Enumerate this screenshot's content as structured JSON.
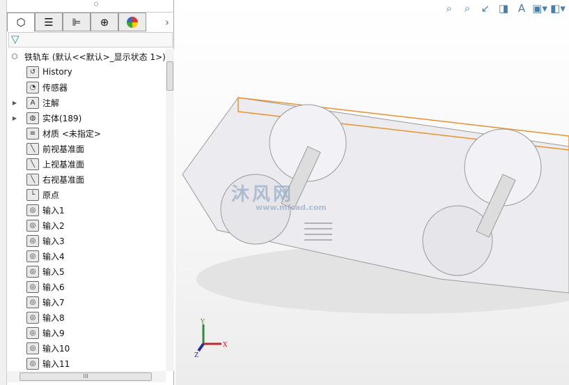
{
  "tabs": [
    {
      "icon": "feature-manager-icon"
    },
    {
      "icon": "property-manager-icon"
    },
    {
      "icon": "configuration-manager-icon"
    },
    {
      "icon": "dimxpert-icon"
    },
    {
      "icon": "display-manager-icon"
    }
  ],
  "tree": {
    "root": "铁轨车  (默认<<默认>_显示状态 1>)",
    "items": [
      {
        "label": "History",
        "icon": "history-folder-icon",
        "expand": false
      },
      {
        "label": "传感器",
        "icon": "sensors-folder-icon",
        "expand": false
      },
      {
        "label": "注解",
        "icon": "annotations-folder-icon",
        "expand": true
      },
      {
        "label": "实体(189)",
        "icon": "solid-bodies-folder-icon",
        "expand": true
      },
      {
        "label": "材质 <未指定>",
        "icon": "material-icon",
        "expand": false
      },
      {
        "label": "前视基准面",
        "icon": "plane-icon",
        "expand": false
      },
      {
        "label": "上视基准面",
        "icon": "plane-icon",
        "expand": false
      },
      {
        "label": "右视基准面",
        "icon": "plane-icon",
        "expand": false
      },
      {
        "label": "原点",
        "icon": "origin-icon",
        "expand": false
      },
      {
        "label": "输入1",
        "icon": "imported-body-icon"
      },
      {
        "label": "输入2",
        "icon": "imported-body-icon"
      },
      {
        "label": "输入3",
        "icon": "imported-body-icon"
      },
      {
        "label": "输入4",
        "icon": "imported-body-icon"
      },
      {
        "label": "输入5",
        "icon": "imported-body-icon"
      },
      {
        "label": "输入6",
        "icon": "imported-body-icon"
      },
      {
        "label": "输入7",
        "icon": "imported-body-icon"
      },
      {
        "label": "输入8",
        "icon": "imported-body-icon"
      },
      {
        "label": "输入9",
        "icon": "imported-body-icon"
      },
      {
        "label": "输入10",
        "icon": "imported-body-icon"
      },
      {
        "label": "输入11",
        "icon": "imported-body-icon"
      }
    ]
  },
  "scrollbar": {
    "h_thumb_label": "III"
  },
  "viewport": {
    "watermark": {
      "text": "沐风网",
      "url": "www.mfcad.com"
    },
    "triad": {
      "x": "X",
      "y": "Y",
      "z": "Z"
    },
    "colors": {
      "selection": "#e8912d",
      "x_axis": "#c0282d",
      "y_axis": "#2e8b3a",
      "z_axis": "#1f2f9a"
    }
  }
}
